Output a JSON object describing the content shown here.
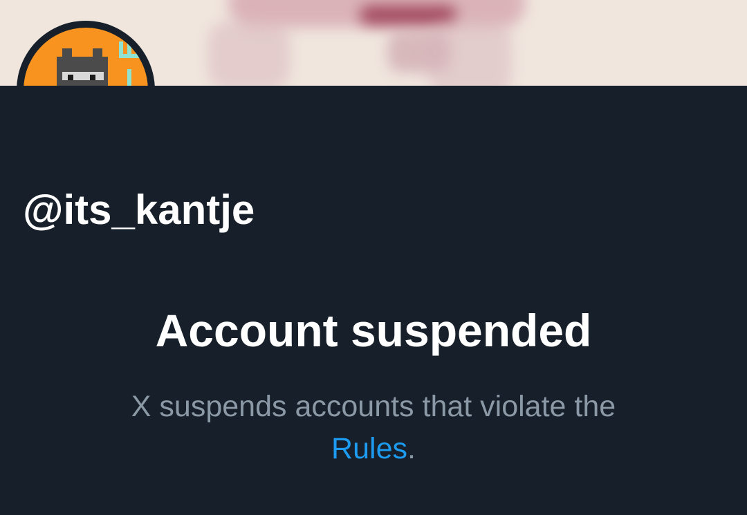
{
  "profile": {
    "handle": "@its_kantje",
    "avatar_icon": "minecraft-character-avatar",
    "avatar_bg_color": "#f7931e"
  },
  "suspension": {
    "title": "Account suspended",
    "message": "X suspends accounts that violate the",
    "rules_link_label": "Rules",
    "trailing_text": "."
  },
  "colors": {
    "background": "#17202a",
    "banner": "#f0e6de",
    "title": "#ffffff",
    "secondary_text": "#8b98a5",
    "link": "#1d9bf0"
  }
}
